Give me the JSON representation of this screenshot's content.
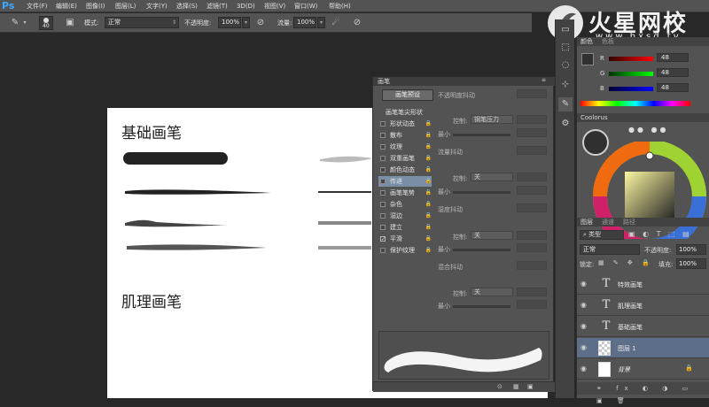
{
  "app": {
    "logo": "Ps"
  },
  "menu": [
    "文件(F)",
    "编辑(E)",
    "图像(I)",
    "图层(L)",
    "文字(Y)",
    "选择(S)",
    "滤镜(T)",
    "3D(D)",
    "视图(V)",
    "窗口(W)",
    "帮助(H)"
  ],
  "watermark": {
    "brand": "火星网校",
    "url": "www.hxsd.tv"
  },
  "options": {
    "brush_size": "40",
    "mode_label": "模式:",
    "mode_value": "正常",
    "opacity_label": "不透明度:",
    "opacity_value": "100%",
    "flow_label": "流量:",
    "flow_value": "100%"
  },
  "canvas": {
    "heading1": "基础画笔",
    "heading2": "肌理画笔"
  },
  "brush_panel": {
    "title": "画笔",
    "presets_button": "画笔预设",
    "top_right_label": "不透明度抖动",
    "categories": [
      {
        "label": "画笔笔尖形状",
        "checkbox": false
      },
      {
        "label": "形状动态",
        "checkbox": true,
        "checked": false
      },
      {
        "label": "散布",
        "checkbox": true,
        "checked": false
      },
      {
        "label": "纹理",
        "checkbox": true,
        "checked": false
      },
      {
        "label": "双重画笔",
        "checkbox": true,
        "checked": false
      },
      {
        "label": "颜色动态",
        "checkbox": true,
        "checked": false
      },
      {
        "label": "传递",
        "checkbox": true,
        "checked": false,
        "selected": true
      },
      {
        "label": "画笔笔势",
        "checkbox": true,
        "checked": false
      },
      {
        "label": "杂色",
        "checkbox": true,
        "checked": false
      },
      {
        "label": "湿边",
        "checkbox": true,
        "checked": false
      },
      {
        "label": "建立",
        "checkbox": true,
        "checked": false
      },
      {
        "label": "平滑",
        "checkbox": true,
        "checked": true
      },
      {
        "label": "保护纹理",
        "checkbox": true,
        "checked": false
      }
    ],
    "sections": [
      {
        "control_label": "控制:",
        "control_value": "钢笔压力",
        "min_label": "最小"
      },
      {
        "title": "流量抖动",
        "control_label": "控制:",
        "control_value": "关",
        "min_label": "最小"
      },
      {
        "title": "湿度抖动",
        "control_label": "控制:",
        "control_value": "关",
        "min_label": "最小"
      },
      {
        "title": "混合抖动",
        "control_label": "控制:",
        "control_value": "关",
        "min_label": "最小"
      }
    ]
  },
  "color_panel": {
    "tabs": [
      "颜色",
      "色板"
    ],
    "r_label": "R",
    "r_value": "48",
    "g_label": "G",
    "g_value": "48",
    "b_label": "B",
    "b_value": "48"
  },
  "coolorus": {
    "title": "Coolorus"
  },
  "layers_panel": {
    "tabs": [
      "图层",
      "通道",
      "路径"
    ],
    "kind_label": "类型",
    "blend_mode": "正常",
    "opacity_label": "不透明度:",
    "opacity_value": "100%",
    "lock_label": "锁定:",
    "fill_label": "填充:",
    "fill_value": "100%",
    "layers": [
      {
        "name": "特效画笔",
        "type": "text"
      },
      {
        "name": "肌理画笔",
        "type": "text"
      },
      {
        "name": "基础画笔",
        "type": "text"
      },
      {
        "name": "图层 1",
        "type": "pixel",
        "selected": true
      },
      {
        "name": "背景",
        "type": "background"
      }
    ]
  }
}
